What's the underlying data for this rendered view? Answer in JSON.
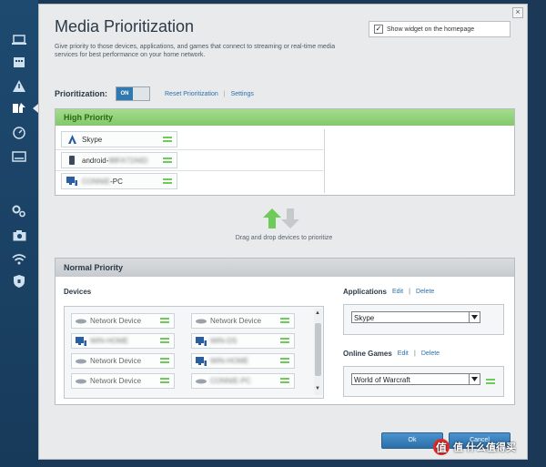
{
  "page": {
    "title": "Media Prioritization",
    "description": "Give priority to those devices, applications, and games that connect to streaming or real-time media services for best performance on your home network.",
    "show_widget_label": "Show widget on the homepage",
    "show_widget_checked": true
  },
  "prioritization": {
    "label": "Prioritization:",
    "toggle_on": "ON",
    "reset_link": "Reset Prioritization",
    "settings_link": "Settings",
    "separator": "|"
  },
  "high_priority": {
    "title": "High Priority",
    "devices": [
      {
        "name": "Skype",
        "icon": "skype-icon",
        "blurred": false
      },
      {
        "name": "android-",
        "redacted": "88FA72A6D",
        "icon": "phone-icon",
        "blurred": true
      },
      {
        "name": "-PC",
        "redacted": "CONNIE",
        "icon": "computer-icon",
        "blurred": true
      }
    ]
  },
  "drag_hint": "Drag and drop devices to prioritize",
  "normal_priority": {
    "title": "Normal Priority",
    "devices_label": "Devices",
    "devices": [
      {
        "name": "Network Device",
        "icon": "network-device-icon",
        "blurred": false
      },
      {
        "name": "Network Device",
        "icon": "network-device-icon",
        "blurred": false
      },
      {
        "name": "WIN-HOME",
        "icon": "computer-icon",
        "blurred": true
      },
      {
        "name": "WIN-DS",
        "icon": "computer-icon",
        "blurred": true
      },
      {
        "name": "Network Device",
        "icon": "network-device-icon",
        "blurred": false
      },
      {
        "name": "WIN-HOME",
        "icon": "computer-icon",
        "blurred": true
      },
      {
        "name": "Network Device",
        "icon": "network-device-icon",
        "blurred": false
      },
      {
        "name": "CONNIE-PC",
        "icon": "computer-icon",
        "blurred": true
      }
    ],
    "applications": {
      "label": "Applications",
      "edit": "Edit",
      "delete": "Delete",
      "selected": "Skype"
    },
    "games": {
      "label": "Online Games",
      "edit": "Edit",
      "delete": "Delete",
      "selected": "World of Warcraft"
    }
  },
  "buttons": {
    "ok": "Ok",
    "cancel": "Cancel"
  },
  "watermark": "值 什么值得买",
  "colors": {
    "accent": "#2f79b0",
    "high_priority_bar": "#84c86b",
    "grip": "#6ecb5a"
  }
}
